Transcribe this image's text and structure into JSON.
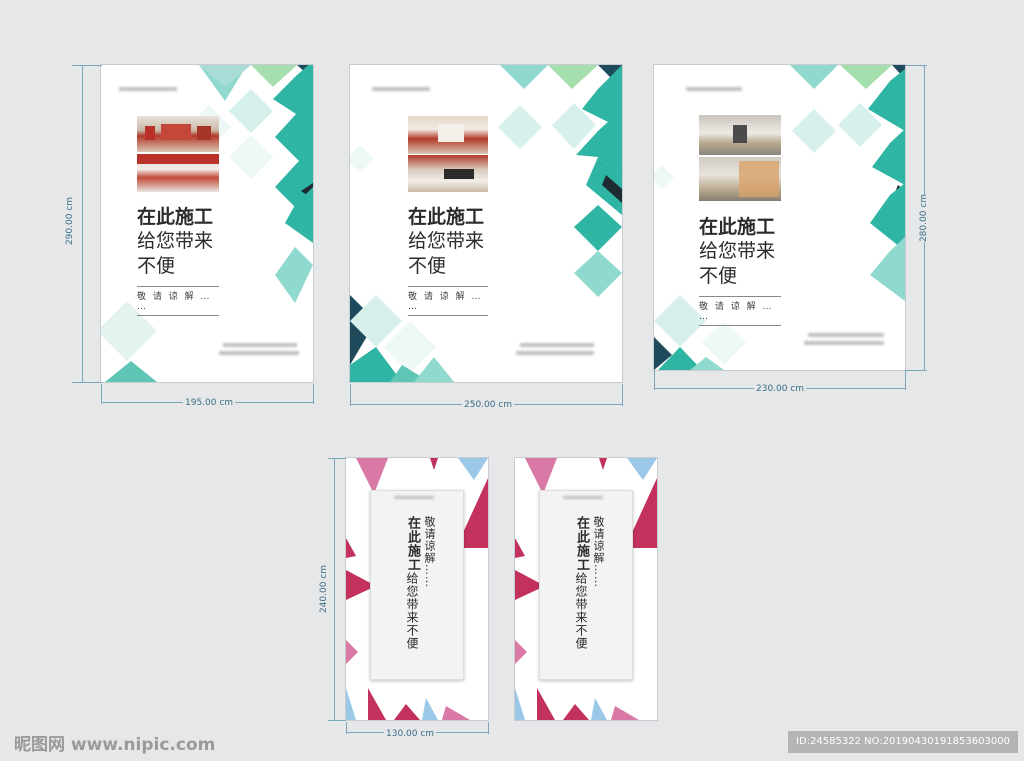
{
  "panel1": {
    "title": "在此施工",
    "line2": "给您带来",
    "line3": "不便",
    "sub": "敬 请 谅 解 … …",
    "width_label": "195.00 cm",
    "height_label": "290.00 cm"
  },
  "panel2": {
    "title": "在此施工",
    "line2": "给您带来",
    "line3": "不便",
    "sub": "敬 请 谅 解 … …",
    "width_label": "250.00 cm"
  },
  "panel3": {
    "title": "在此施工",
    "line2": "给您带来",
    "line3": "不便",
    "sub": "敬 请 谅 解 … …",
    "width_label": "230.00 cm",
    "height_label": "280.00 cm"
  },
  "panel4": {
    "col1": "敬请谅解……",
    "col2_bold": "在此施工",
    "col2_rest": "给您带来不便",
    "width_label": "130.00 cm",
    "height_label": "240.00 cm"
  },
  "panel5": {
    "col1": "敬请谅解……",
    "col2_bold": "在此施工",
    "col2_rest": "给您带来不便"
  },
  "footer": {
    "watermark": "昵图网 www.nipic.com",
    "id_text": "ID:24585322 NO:20190430191853603000"
  },
  "colors": {
    "teal": "#2fb5a3",
    "light_teal": "#8fd9cf",
    "pale_teal": "#d6f0ec",
    "green": "#a6dfae",
    "navy": "#1e4a5c",
    "magenta": "#c2325c",
    "pink": "#d97aa6",
    "sky": "#9cc8e8"
  }
}
